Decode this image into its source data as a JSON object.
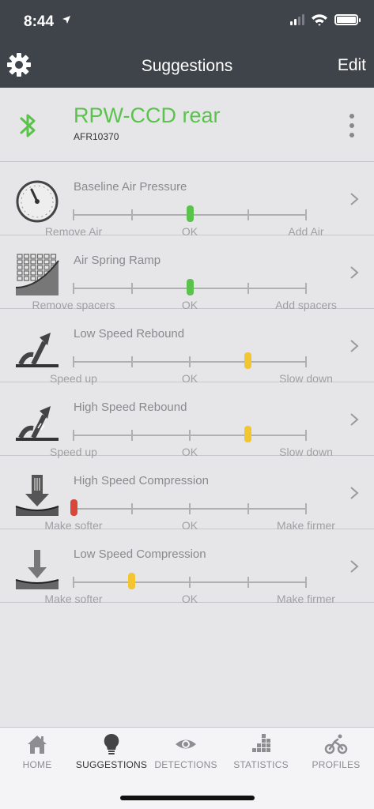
{
  "status_bar": {
    "time": "8:44",
    "location_icon": "location-arrow-icon"
  },
  "nav": {
    "title": "Suggestions",
    "edit_label": "Edit",
    "settings_icon": "gear-icon"
  },
  "device": {
    "name": "RPW-CCD rear",
    "id": "AFR10370",
    "icon": "bluetooth-icon",
    "name_color": "#5bc24d"
  },
  "suggestions": [
    {
      "title": "Baseline Air Pressure",
      "left": "Remove Air",
      "mid": "OK",
      "right": "Add Air",
      "level": 0.5,
      "status": "ok",
      "color": "#5bc24d",
      "icon": "gauge-icon"
    },
    {
      "title": "Air Spring Ramp",
      "left": "Remove spacers",
      "mid": "OK",
      "right": "Add spacers",
      "level": 0.5,
      "status": "ok",
      "color": "#5bc24d",
      "icon": "spring-ramp-icon"
    },
    {
      "title": "Low Speed Rebound",
      "left": "Speed up",
      "mid": "OK",
      "right": "Slow down",
      "level": 0.75,
      "status": "warn",
      "color": "#f2c531",
      "icon": "low-speed-rebound-icon"
    },
    {
      "title": "High Speed Rebound",
      "left": "Speed up",
      "mid": "OK",
      "right": "Slow down",
      "level": 0.75,
      "status": "warn",
      "color": "#f2c531",
      "icon": "high-speed-rebound-icon"
    },
    {
      "title": "High Speed Compression",
      "left": "Make softer",
      "mid": "OK",
      "right": "Make firmer",
      "level": 0.0,
      "status": "bad",
      "color": "#d9473a",
      "icon": "high-speed-compression-icon"
    },
    {
      "title": "Low Speed Compression",
      "left": "Make softer",
      "mid": "OK",
      "right": "Make firmer",
      "level": 0.25,
      "status": "warn",
      "color": "#f2c531",
      "icon": "low-speed-compression-icon"
    }
  ],
  "tabs": [
    {
      "label": "HOME",
      "icon": "house-icon",
      "active": false
    },
    {
      "label": "SUGGESTIONS",
      "icon": "lightbulb-icon",
      "active": true
    },
    {
      "label": "DETECTIONS",
      "icon": "eye-icon",
      "active": false
    },
    {
      "label": "STATISTICS",
      "icon": "bar-chart-icon",
      "active": false
    },
    {
      "label": "PROFILES",
      "icon": "cyclist-icon",
      "active": false
    }
  ]
}
